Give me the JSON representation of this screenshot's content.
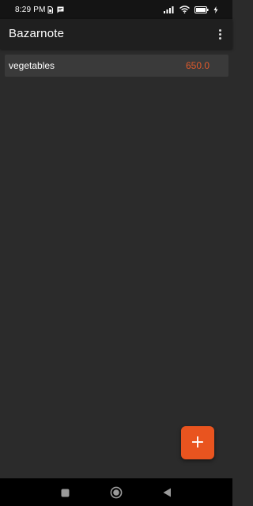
{
  "status_bar": {
    "time": "8:29 PM",
    "left_icons": [
      "sim-card-icon",
      "message-icon"
    ],
    "right_icons": [
      "signal-icon",
      "wifi-icon",
      "battery-icon",
      "charging-icon"
    ]
  },
  "app_bar": {
    "title": "Bazarnote",
    "overflow_icon": "more-vertical-icon"
  },
  "list": {
    "items": [
      {
        "name": "vegetables",
        "amount": "650.0"
      }
    ]
  },
  "fab": {
    "label": "+",
    "icon": "plus-icon"
  },
  "nav_bar": {
    "buttons": [
      "recents-square-icon",
      "home-circle-icon",
      "back-triangle-icon"
    ]
  },
  "colors": {
    "accent": "#e9541f",
    "amount": "#e05a2b",
    "background": "#2b2b2b",
    "app_bar": "#1f1f1f",
    "list_item": "#3a3a3a"
  }
}
